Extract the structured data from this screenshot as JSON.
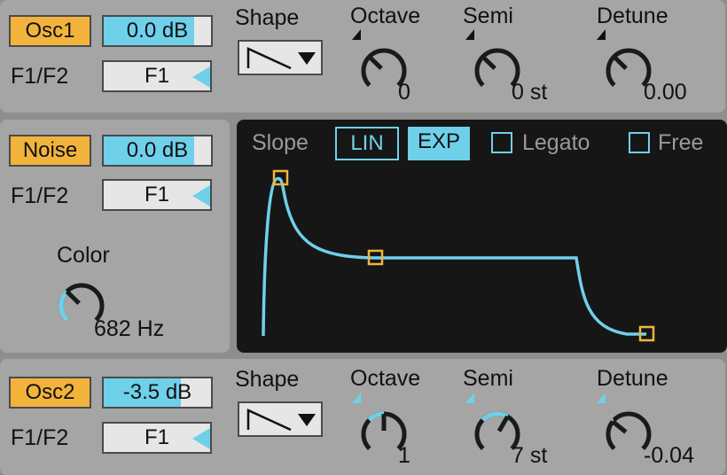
{
  "colors": {
    "accent": "#6fd0ea",
    "toggle": "#f2b33d",
    "envelope_bg": "#161616",
    "handle": "#f2b33d"
  },
  "osc1": {
    "toggle": "Osc1",
    "volume": "0.0 dB",
    "volume_level": 0.84,
    "filter_label": "F1/F2",
    "filter": "F1",
    "shape_label": "Shape",
    "shape_icon": "saw-wave-icon",
    "octave": {
      "label": "Octave",
      "value": "0",
      "pos": 0.33,
      "default": 0.33
    },
    "semi": {
      "label": "Semi",
      "value": "0 st",
      "pos": 0.33,
      "default": 0.33
    },
    "detune": {
      "label": "Detune",
      "value": "0.00",
      "pos": 0.33,
      "default": 0.33
    }
  },
  "noise": {
    "toggle": "Noise",
    "volume": "0.0 dB",
    "volume_level": 0.84,
    "filter_label": "F1/F2",
    "filter": "F1",
    "color": {
      "label": "Color",
      "value": "682 Hz",
      "pos": 0.33,
      "default": 0.0
    }
  },
  "envelope": {
    "slope_label": "Slope",
    "lin": "LIN",
    "exp": "EXP",
    "slope_selected": "EXP",
    "legato_label": "Legato",
    "legato": false,
    "free_label": "Free",
    "free": false
  },
  "osc2": {
    "toggle": "Osc2",
    "volume": "-3.5 dB",
    "volume_level": 0.72,
    "filter_label": "F1/F2",
    "filter": "F1",
    "shape_label": "Shape",
    "shape_icon": "saw-wave-icon",
    "octave": {
      "label": "Octave",
      "value": "1",
      "pos": 0.5,
      "default": 0.33
    },
    "semi": {
      "label": "Semi",
      "value": "7 st",
      "pos": 0.61,
      "default": 0.33
    },
    "detune": {
      "label": "Detune",
      "value": "-0.04",
      "pos": 0.31,
      "default": 0.33
    }
  }
}
